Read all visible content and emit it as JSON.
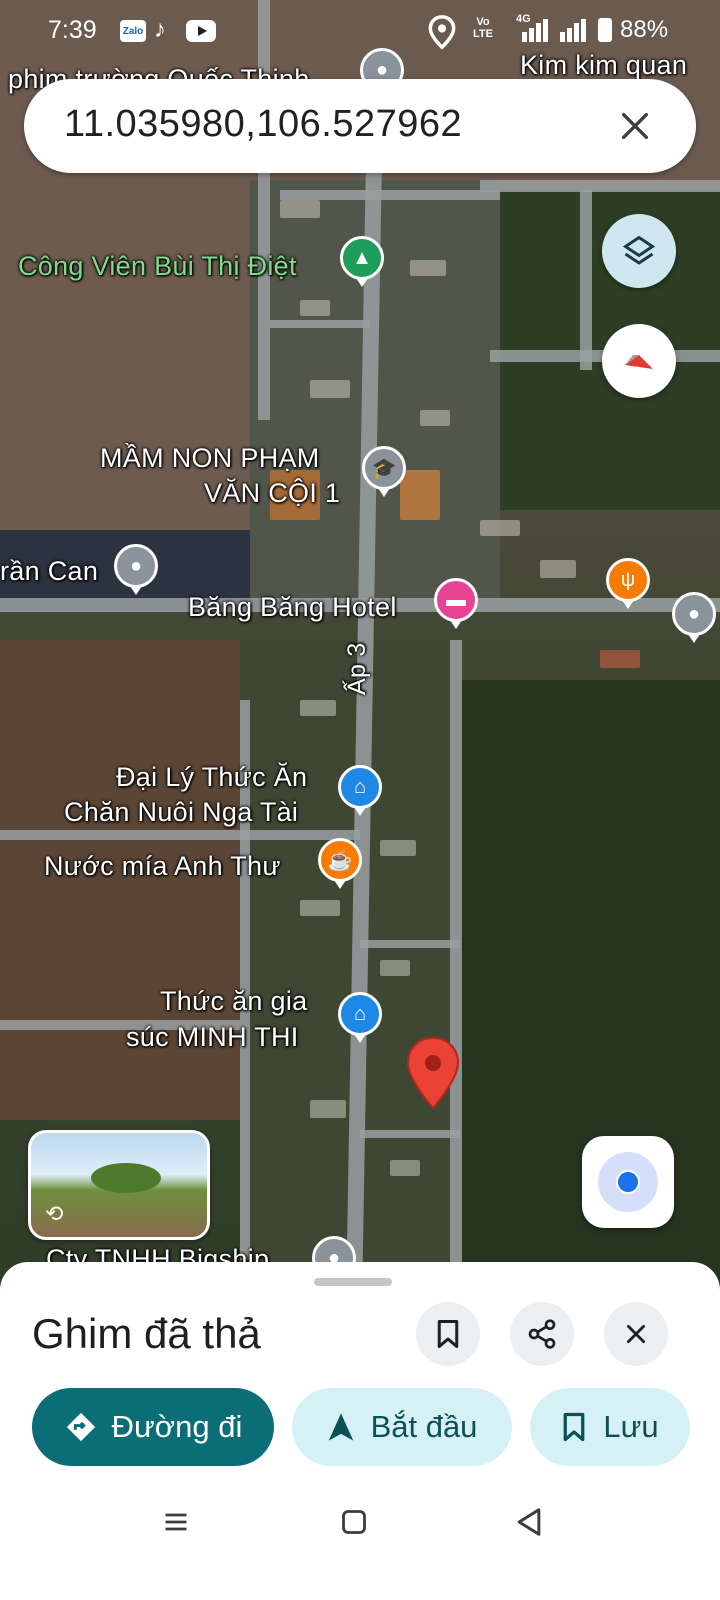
{
  "status_bar": {
    "time": "7:39",
    "battery": "88%",
    "network": "4G",
    "volte": "Vo LTE",
    "apps": [
      "Zalo",
      "TikTok",
      "YouTube"
    ]
  },
  "search": {
    "query": "11.035980,106.527962"
  },
  "map_labels": {
    "phim_truong": "phim trường Quốc Thịnh",
    "kim_kim": "Kim kim quan",
    "cong_vien": "Công Viên Bùi Thị Điệt",
    "mam_non_1": "MẦM NON PHẠM",
    "mam_non_2": "VĂN CỘI 1",
    "tran_can": "rần Can",
    "hotel": "Băng Băng Hotel",
    "ap3": "Ấp 3",
    "dai_ly_1": "Đại Lý Thức Ăn",
    "dai_ly_2": "Chăn Nuôi Nga Tài",
    "nuoc_mia": "Nước mía Anh Thư",
    "thuc_an_1": "Thức ăn gia",
    "thuc_an_2": "súc MINH THI",
    "cty": "Cty TNHH Bigship"
  },
  "sheet": {
    "title": "Ghim đã thả",
    "directions": "Đường đi",
    "start": "Bắt đầu",
    "save": "Lưu"
  },
  "colors": {
    "primary": "#0b6e76",
    "pill_light": "#d6f1f6",
    "pin_red": "#ea4335",
    "blue_poi": "#1e88e5",
    "orange_poi": "#f57c00",
    "pink_poi": "#e84393",
    "green_poi": "#1e9e5a"
  }
}
